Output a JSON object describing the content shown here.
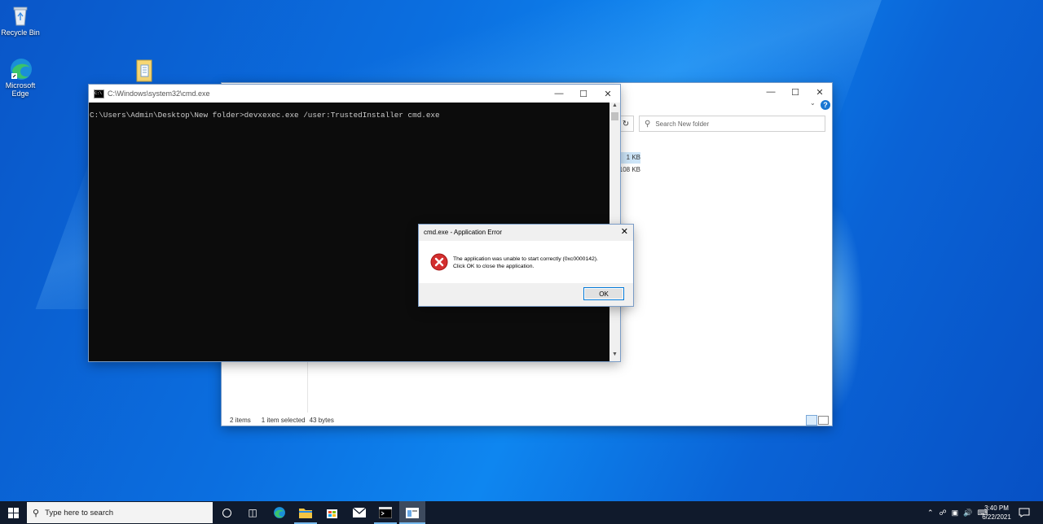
{
  "desktop": {
    "icons": [
      {
        "label": "Recycle Bin"
      },
      {
        "label": "Microsoft Edge"
      },
      {
        "label": ""
      }
    ]
  },
  "explorer": {
    "search_placeholder": "Search New folder",
    "sizes": [
      "1 KB",
      "108 KB"
    ],
    "status": {
      "items": "2 items",
      "selected": "1 item selected",
      "bytes": "43 bytes"
    }
  },
  "cmd": {
    "title": "C:\\Windows\\system32\\cmd.exe",
    "console_line": "C:\\Users\\Admin\\Desktop\\New folder>devxexec.exe /user:TrustedInstaller cmd.exe"
  },
  "dialog": {
    "title": "cmd.exe - Application Error",
    "message_line1": "The application was unable to start correctly (0xc0000142).",
    "message_line2": "Click OK to close the application.",
    "ok_label": "OK"
  },
  "taskbar": {
    "search_placeholder": "Type here to search",
    "time": "3:40 PM",
    "date": "6/22/2021"
  },
  "colors": {
    "accent": "#0078d7",
    "error_red": "#d32f2f",
    "taskbar": "#101a2c"
  }
}
